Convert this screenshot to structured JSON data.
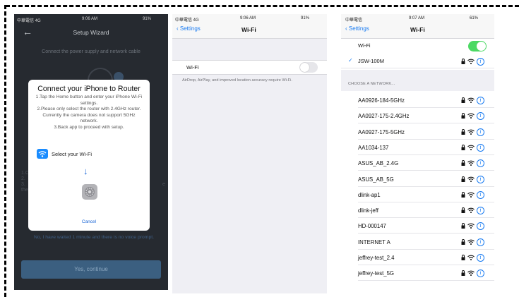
{
  "setup": {
    "status_left": "中華電信  4G",
    "status_time": "9:06 AM",
    "status_right": "91%",
    "back_label": "←",
    "title": "Setup Wizard",
    "instruction": "Connect the power supply and network cable",
    "side_left": "1.C\n2.\n3.\nthe",
    "side_right": "e",
    "waited_text": "No, I have waited 1 minute and there is no voice prompt.",
    "yes_button": "Yes, continue",
    "modal": {
      "title": "Connect your iPhone to Router",
      "body": "1.Tap the Home button and enter your iPhone Wi-Fi settings.\n2.Please only select the router with 2.4GHz router. Currently the camera does not support 5GHz network.\n3.Back app to proceed with setup.",
      "select_wifi": "Select your Wi-Fi",
      "arrow": "↓",
      "cancel": "Cancel"
    }
  },
  "wifi_off": {
    "status_left": "中華電信  4G",
    "status_time": "9:06 AM",
    "status_right": "91%",
    "back_label": "Settings",
    "title": "Wi-Fi",
    "wifi_label": "Wi-Fi",
    "note": "AirDrop, AirPlay, and improved location accuracy require Wi-Fi."
  },
  "wifi_on": {
    "status_left": "中華電信",
    "status_time": "9:07 AM",
    "status_right": "61%",
    "back_label": "Settings",
    "title": "Wi-Fi",
    "wifi_label": "Wi-Fi",
    "connected": "JSW-100M",
    "section_label": "CHOOSE A NETWORK...",
    "networks": [
      "AA0926-184-5GHz",
      "AA0927-175-2.4GHz",
      "AA0927-175-5GHz",
      "AA1034-137",
      "ASUS_AB_2.4G",
      "ASUS_AB_5G",
      "dlink-ap1",
      "dlink-jeff",
      "HD-000147",
      "INTERNET A",
      "jeffrey-test_2.4",
      "jeffrey-test_5G"
    ]
  },
  "colors": {
    "ios_blue": "#1a7cf2",
    "toggle_green": "#4cd964",
    "dark_bg": "#262a30"
  }
}
